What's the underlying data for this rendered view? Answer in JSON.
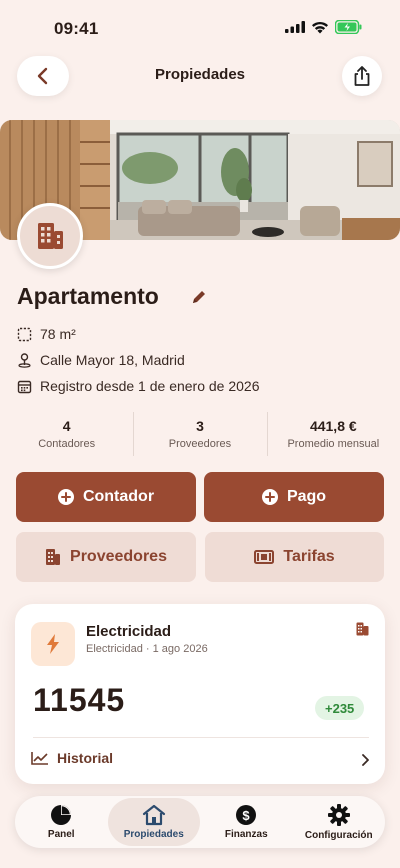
{
  "status_bar": {
    "time": "09:41"
  },
  "header": {
    "title": "Propiedades"
  },
  "property": {
    "name": "Apartamento",
    "area": "78 m²",
    "address": "Calle Mayor 18, Madrid",
    "registered": "Registro desde 1 de enero de 2026"
  },
  "stats": [
    {
      "value": "4",
      "label": "Contadores"
    },
    {
      "value": "3",
      "label": "Proveedores"
    },
    {
      "value": "441,8 €",
      "label": "Promedio mensual"
    }
  ],
  "actions": {
    "add_meter": "Contador",
    "add_payment": "Pago",
    "providers": "Proveedores",
    "rates": "Tarifas"
  },
  "meter_card": {
    "title": "Electricidad",
    "subtitle": "Electricidad · 1 ago 2026",
    "reading": "11545",
    "delta": "+235",
    "history_label": "Historial"
  },
  "tabs": [
    {
      "label": "Panel",
      "icon": "pie-chart-icon"
    },
    {
      "label": "Propiedades",
      "icon": "house-icon"
    },
    {
      "label": "Finanzas",
      "icon": "dollar-coin-icon"
    },
    {
      "label": "Configuración",
      "icon": "gear-icon"
    }
  ],
  "colors": {
    "accent": "#9a4a32",
    "background": "#fbf0ec",
    "active_tab": "#2c4b6e",
    "positive": "#2f8a3a"
  }
}
